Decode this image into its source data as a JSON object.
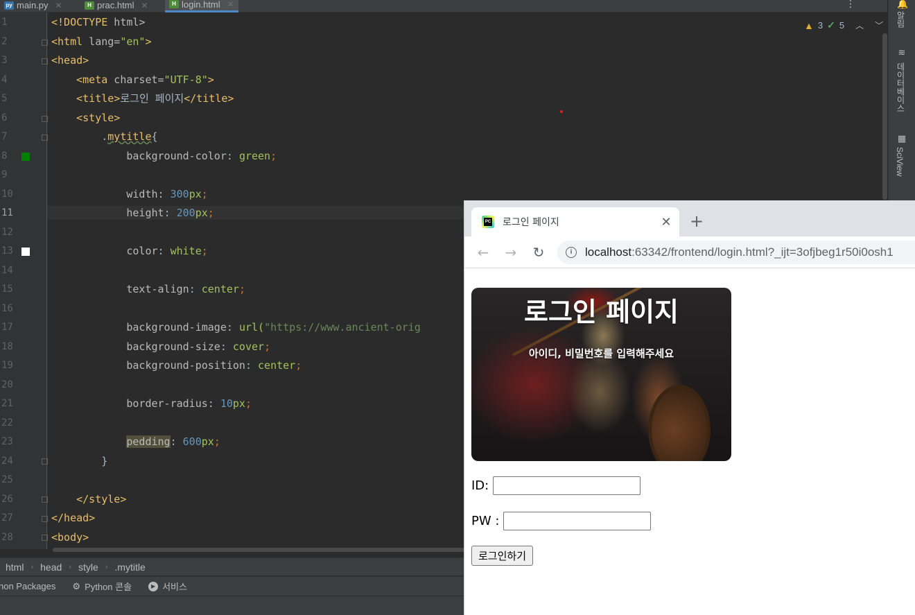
{
  "ide": {
    "tabs": [
      {
        "label": "main.py",
        "active": false
      },
      {
        "label": "prac.html",
        "active": false
      },
      {
        "label": "login.html",
        "active": true
      }
    ],
    "inspections": {
      "warnings": "3",
      "ok": "5"
    },
    "right_panels": {
      "notifications": "알림",
      "database": "데이터베이스",
      "sciview": "SciView"
    },
    "line_numbers": [
      "1",
      "2",
      "3",
      "4",
      "5",
      "6",
      "7",
      "8",
      "9",
      "10",
      "11",
      "12",
      "13",
      "14",
      "15",
      "16",
      "17",
      "18",
      "19",
      "20",
      "21",
      "22",
      "23",
      "24",
      "25",
      "26",
      "27",
      "28"
    ],
    "code": {
      "l1_doctype": "<!DOCTYPE",
      "l1_html": " html>",
      "l2_open": "<html",
      "l2_attr": " lang=",
      "l2_val": "\"en\"",
      "l2_close": ">",
      "l3": "<head>",
      "l4_open": "    <meta",
      "l4_attr": " charset=",
      "l4_val": "\"UTF-8\"",
      "l4_close": ">",
      "l5_open": "    <title>",
      "l5_text": "로그인 페이지",
      "l5_close": "</title>",
      "l6": "    <style>",
      "l7_indent": "        ",
      "l7_dot": ".",
      "l7_sel": "mytitle",
      "l7_brace": "{",
      "l8_prop": "            background-color",
      "l8_val": "green",
      "l10_prop": "            width",
      "l10_num": "300",
      "l10_unit": "px",
      "l11_prop": "            height",
      "l11_num": "200",
      "l11_unit": "px",
      "l13_prop": "            color",
      "l13_val": "white",
      "l15_prop": "            text-align",
      "l15_val": "center",
      "l17_prop": "            background-image",
      "l17_fn": "url(",
      "l17_str": "\"https://www.ancient-orig",
      "l18_prop": "            background-size",
      "l18_val": "cover",
      "l19_prop": "            background-position",
      "l19_val": "center",
      "l21_prop": "            border-radius",
      "l21_num": "10",
      "l21_unit": "px",
      "l23_indent": "            ",
      "l23_prop": "pedding",
      "l23_num": "600",
      "l23_unit": "px",
      "l24": "        }",
      "l26": "    </style>",
      "l27": "</head>",
      "l28": "<body>"
    },
    "breadcrumb": [
      "html",
      "head",
      "style",
      ".mytitle"
    ],
    "tool_windows": [
      "hon Packages",
      "Python 콘솔",
      "서비스"
    ]
  },
  "browser": {
    "tab_title": "로그인 페이지",
    "favicon_text": "PC",
    "url_host": "localhost",
    "url_rest": ":63342/frontend/login.html?_ijt=3ofjbeg1r50i0osh1",
    "page": {
      "title": "로그인 페이지",
      "subtitle": "아이디, 비밀번호를 입력해주세요",
      "id_label": "ID:",
      "id_value": "",
      "pw_label": "PW :",
      "pw_value": "",
      "login_button": "로그인하기"
    }
  },
  "colors": {
    "swatch_green": "#008000",
    "swatch_white": "#ffffff",
    "accent": "#4a88c7"
  }
}
